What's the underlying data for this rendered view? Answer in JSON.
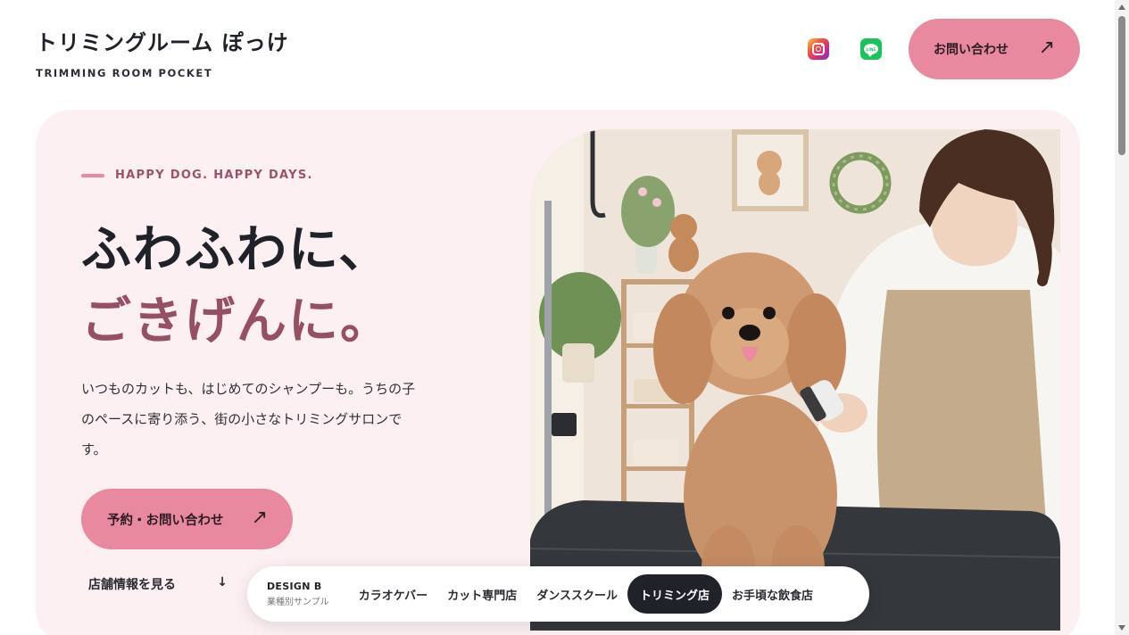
{
  "brand": {
    "title": "トリミングルーム ぽっけ",
    "subtitle": "TRIMMING ROOM POCKET"
  },
  "header": {
    "social": [
      {
        "icon": "instagram-icon"
      },
      {
        "icon": "line-icon",
        "glyph": "LINE"
      }
    ],
    "cta_label": "お問い合わせ",
    "cta_arrow": "↗"
  },
  "hero": {
    "kicker": "HAPPY DOG. HAPPY DAYS.",
    "headline_line1": "ふわふわに、",
    "headline_line2": "ごきげんに。",
    "lead": "いつものカットも、はじめてのシャンプーも。うちの子のペースに寄り添う、街の小さなトリミングサロンです。",
    "cta_label": "予約・お問い合わせ",
    "cta_arrow": "↗",
    "store_link_label": "店舗情報を見る",
    "store_link_arrow": "↓"
  },
  "design_nav": {
    "title": "DESIGN B",
    "subtitle": "業種別サンプル",
    "items": [
      "カラオケバー",
      "カット専門店",
      "ダンススクール",
      "トリミング店",
      "お手頃な飲食店"
    ],
    "active": "トリミング店"
  },
  "colors": {
    "accent_pink": "#e8899f",
    "hero_bg": "#fdf0f3",
    "headline_accent": "#955062",
    "dark": "#1f2229"
  }
}
